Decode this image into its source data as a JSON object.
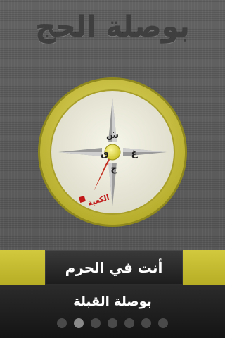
{
  "app": {
    "title": "بوصلة الحج"
  },
  "compass": {
    "directions": {
      "north": "ش",
      "south": "ج",
      "east": "غ",
      "west": "ق"
    },
    "kaaba_label": "الكعبة",
    "colors": {
      "ring": "#c9c043",
      "face": "#ecebd8",
      "needle": "#d63a2a",
      "hub": "#d9d22a"
    }
  },
  "status": {
    "text": "أنت في الحرم"
  },
  "bottom": {
    "page_label": "بوصلة القبلة",
    "page_count": 7,
    "active_index": 1
  }
}
